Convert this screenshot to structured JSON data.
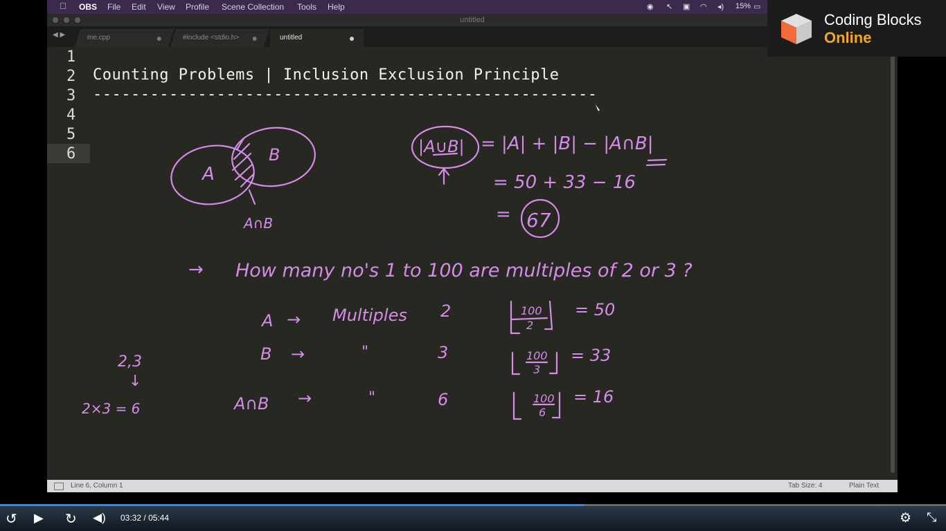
{
  "menubar": {
    "app": "OBS",
    "items": [
      "File",
      "Edit",
      "View",
      "Profile",
      "Scene Collection",
      "Tools",
      "Help"
    ],
    "battery": "15%"
  },
  "window": {
    "title": "untitled",
    "tabs": [
      {
        "label": "me.cpp"
      },
      {
        "label": "#include <stdio.h>"
      },
      {
        "label": "untitled"
      }
    ],
    "line_numbers": [
      "1",
      "2",
      "3",
      "4",
      "5",
      "6"
    ],
    "code_line2": "Counting Problems | Inclusion Exclusion Principle",
    "code_line3": "-----------------------------------------------------",
    "status_left": "Line 6, Column 1",
    "status_tab_size": "Tab Size: 4",
    "status_syntax": "Plain Text"
  },
  "handwriting": {
    "venn_a": "A",
    "venn_b": "B",
    "venn_label": "A∩B",
    "formula_lhs": "|A∪B|",
    "formula_eq": "= |A| + |B| − |A∩B|",
    "formula_values": "= 50 + 33 − 16",
    "formula_result_eq": "=",
    "formula_result": "67",
    "question_arrow": "→",
    "question": "How many no's 1 to 100 are multiples of 2 or 3 ?",
    "rows": [
      {
        "set": "A",
        "arrow": "→",
        "desc": "Multiples",
        "num": "2",
        "frac_num": "100",
        "frac_den": "2",
        "result": "= 50"
      },
      {
        "set": "B",
        "arrow": "→",
        "desc": "\"",
        "num": "3",
        "frac_num": "100",
        "frac_den": "3",
        "result": "= 33"
      },
      {
        "set": "A∩B",
        "arrow": "→",
        "desc": "\"",
        "num": "6",
        "frac_num": "100",
        "frac_den": "6",
        "result": "= 16"
      }
    ],
    "side_top": "2,3",
    "side_arrow": "↓",
    "side_eq": "2×3 = 6"
  },
  "logo": {
    "line1": "Coding Blocks",
    "line2": "Online"
  },
  "player": {
    "current_time": "03:32",
    "separator": "/",
    "duration": "05:44",
    "progress": 0.617
  },
  "colors": {
    "ink": "#d58ce8",
    "editor_bg": "#272822",
    "logo_accent": "#f5a623",
    "progress": "#2b8cf0"
  }
}
